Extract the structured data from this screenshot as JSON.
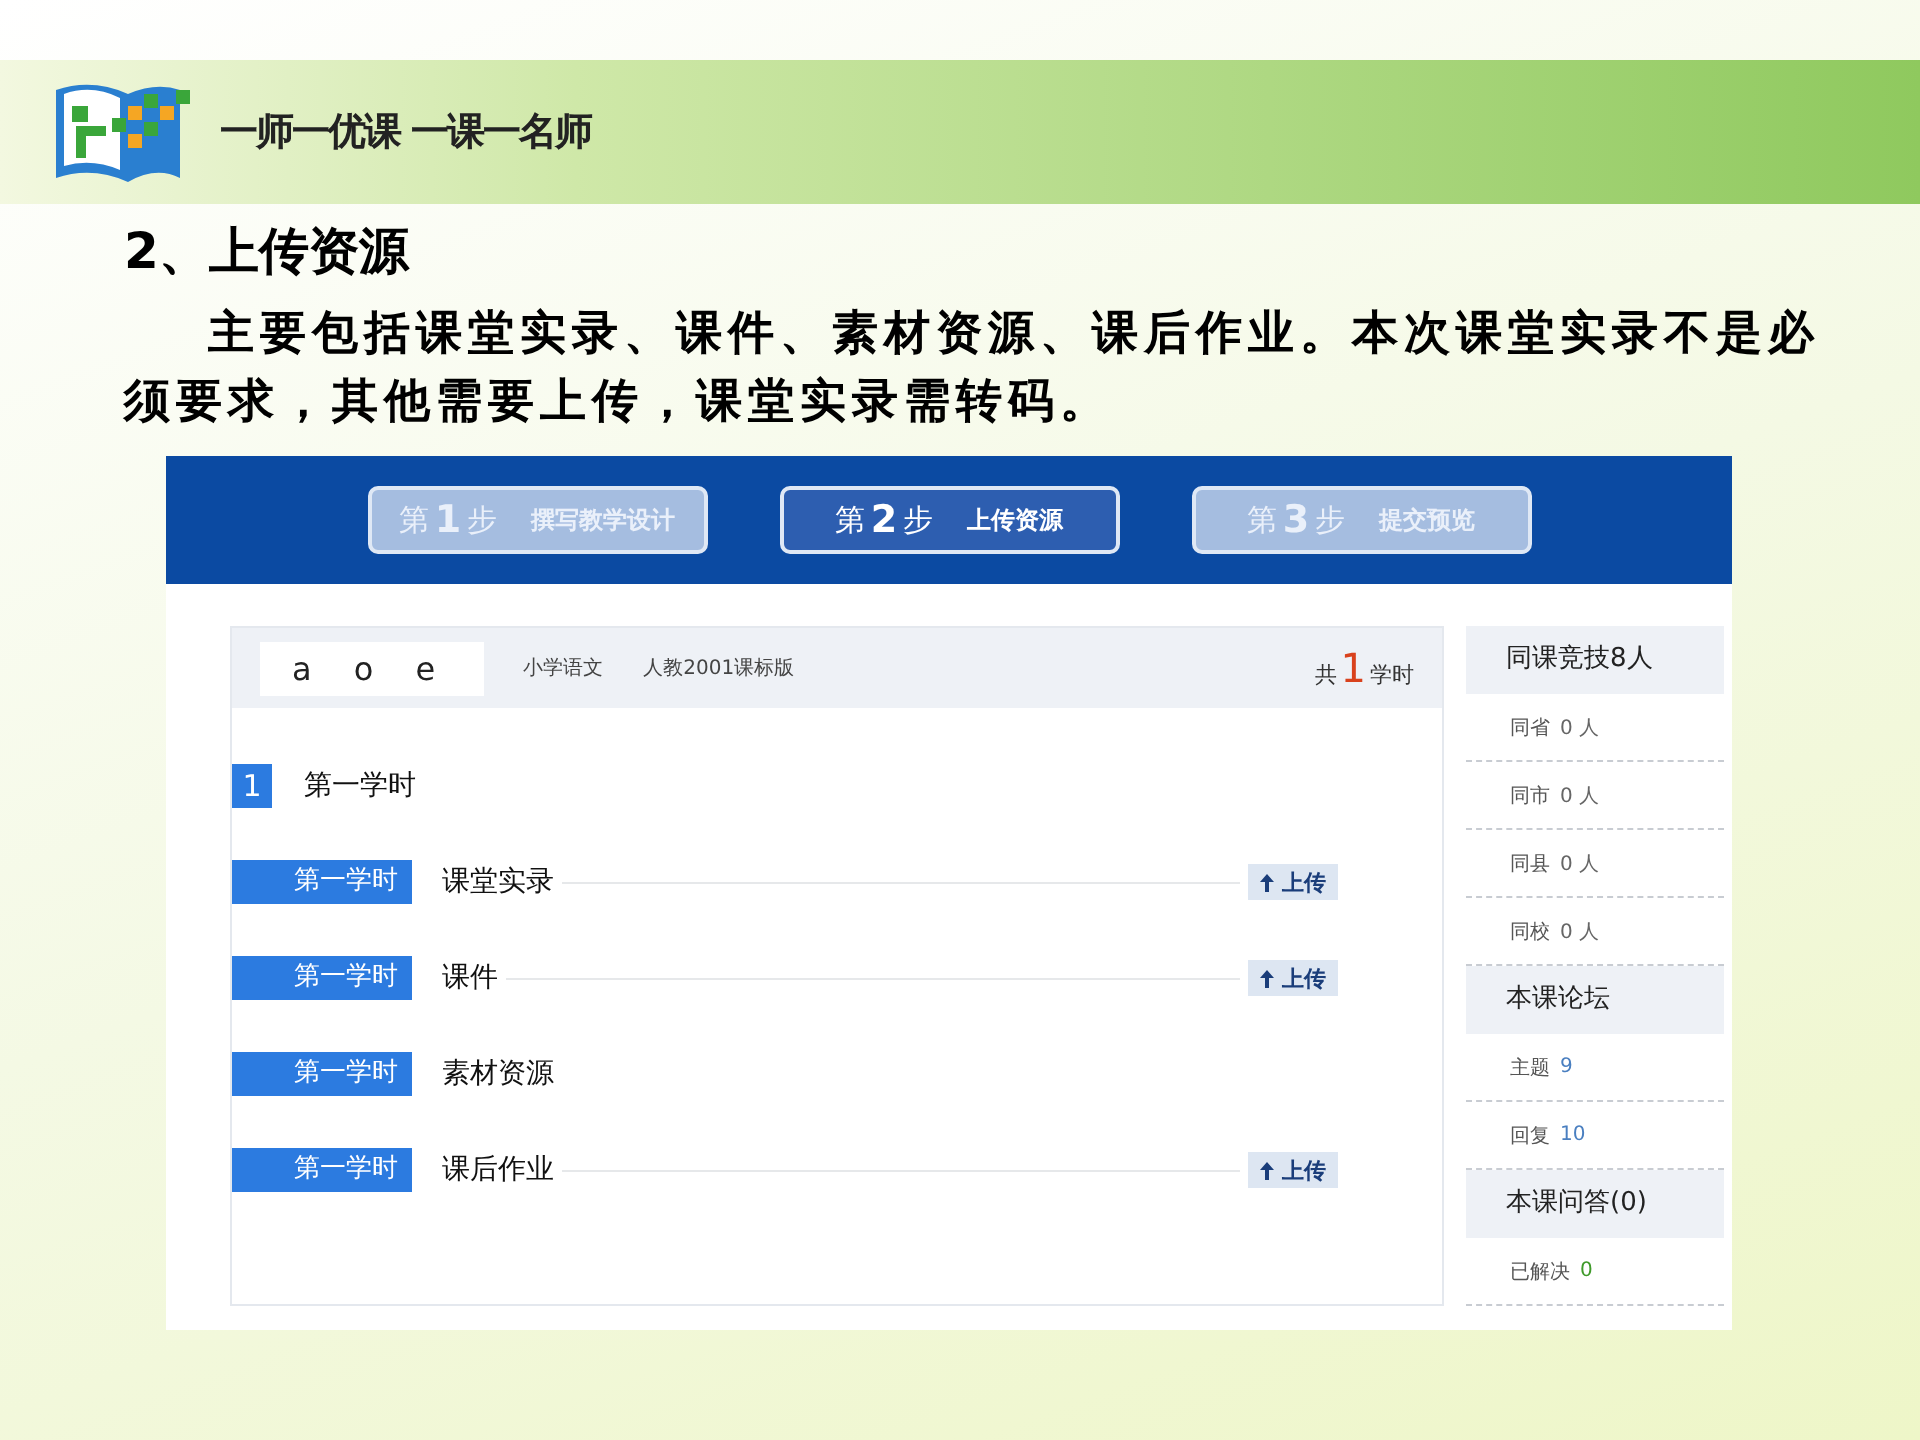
{
  "logo": {
    "slogan": "一师一优课 一课一名师"
  },
  "heading": "2、上传资源",
  "paragraph": "主要包括课堂实录、课件、素材资源、课后作业。本次课堂实录不是必须要求，其他需要上传，课堂实录需转码。",
  "steps": [
    {
      "prefix": "第",
      "num": "1",
      "suffix": "步",
      "label": "撰写教学设计",
      "selected": false
    },
    {
      "prefix": "第",
      "num": "2",
      "suffix": "步",
      "label": "上传资源",
      "selected": true
    },
    {
      "prefix": "第",
      "num": "3",
      "suffix": "步",
      "label": "提交预览",
      "selected": false
    }
  ],
  "course": {
    "title": "a o e",
    "subject": "小学语文",
    "edition": "人教2001课标版",
    "total_prefix": "共",
    "total_num": "1",
    "total_suffix": "学时"
  },
  "lesson": {
    "index": "1",
    "name": "第一学时"
  },
  "resources": [
    {
      "tag": "第一学时",
      "name": "课堂实录",
      "upload": "上传"
    },
    {
      "tag": "第一学时",
      "name": "课件",
      "upload": "上传"
    },
    {
      "tag": "第一学时",
      "name": "素材资源"
    },
    {
      "tag": "第一学时",
      "name": "课后作业",
      "upload": "上传"
    }
  ],
  "sidebar": [
    {
      "title": "同课竞技8人",
      "items": [
        {
          "label": "同省",
          "value": "0 人",
          "color": "#666666"
        },
        {
          "label": "同市",
          "value": "0 人",
          "color": "#666666"
        },
        {
          "label": "同县",
          "value": "0 人",
          "color": "#666666"
        },
        {
          "label": "同校",
          "value": "0 人",
          "color": "#666666"
        }
      ]
    },
    {
      "title": "本课论坛",
      "items": [
        {
          "label": "主题",
          "value": "9",
          "color": "#4a7fc0"
        },
        {
          "label": "回复",
          "value": "10",
          "color": "#4a7fc0"
        }
      ]
    },
    {
      "title": "本课问答(0)",
      "items": [
        {
          "label": "已解决",
          "value": "0",
          "color": "#3f9a2a"
        }
      ]
    }
  ]
}
